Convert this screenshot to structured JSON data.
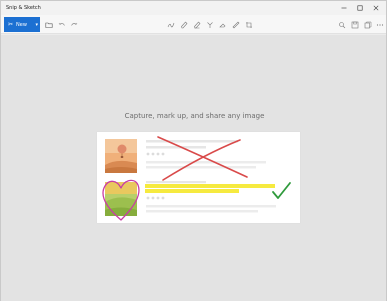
{
  "app": {
    "title": "Snip & Sketch"
  },
  "window_controls": {
    "minimize_icon": "minimize-icon",
    "maximize_icon": "maximize-icon",
    "close_icon": "close-icon"
  },
  "toolbar": {
    "new_label": "New",
    "left_tools": [
      "open-file-icon",
      "undo-icon",
      "redo-icon"
    ],
    "center_tools": [
      "touch-writing-icon",
      "ballpoint-pen-icon",
      "pencil-icon",
      "highlighter-icon",
      "eraser-icon",
      "ruler-icon",
      "crop-icon"
    ],
    "right_tools": [
      "zoom-icon",
      "save-icon",
      "copy-icon",
      "share-icon",
      "more-icon"
    ]
  },
  "canvas": {
    "caption": "Capture, mark up, and share any image"
  },
  "colors": {
    "accent": "#1c70d2",
    "cross_mark": "#d94a4a",
    "highlight": "#f5e82a",
    "checkmark": "#2f9a3c",
    "heart_outline": "#c83ca6"
  }
}
